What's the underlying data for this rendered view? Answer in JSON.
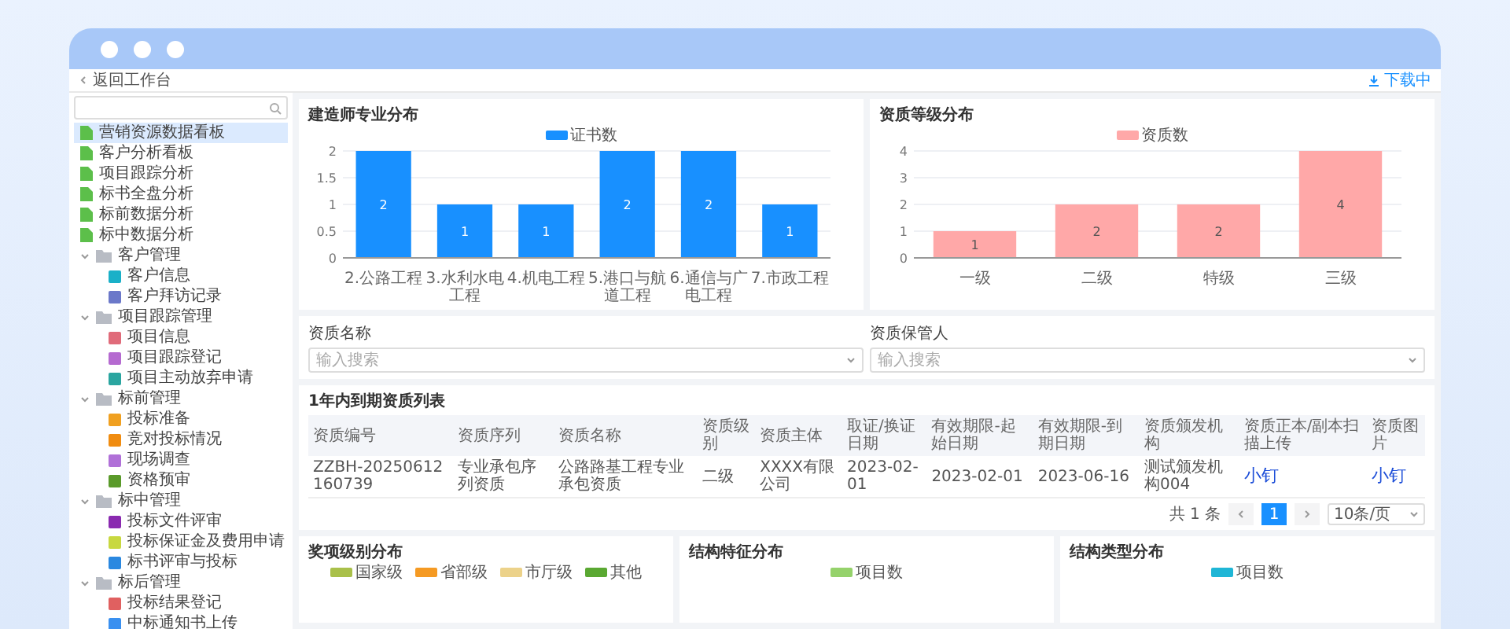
{
  "header": {
    "back_label": "返回工作台",
    "right_link": "下载中"
  },
  "sidebar": {
    "items": [
      {
        "label": "营销资源数据看板",
        "selected": true,
        "color": "#5cbf4a"
      },
      {
        "label": "客户分析看板",
        "selected": false,
        "color": "#5cbf4a"
      },
      {
        "label": "项目跟踪分析",
        "selected": false,
        "color": "#5cbf4a"
      },
      {
        "label": "标书全盘分析",
        "selected": false,
        "color": "#5cbf4a"
      },
      {
        "label": "标前数据分析",
        "selected": false,
        "color": "#5cbf4a"
      },
      {
        "label": "标中数据分析",
        "selected": false,
        "color": "#5cbf4a"
      },
      {
        "label": "客户管理",
        "selected": false,
        "expanded": true,
        "children": [
          {
            "label": "客户信息",
            "selected": false,
            "color": "#1ab0c8"
          },
          {
            "label": "客户拜访记录",
            "selected": false,
            "color": "#6b78c9"
          }
        ]
      },
      {
        "label": "项目跟踪管理",
        "selected": false,
        "expanded": true,
        "children": [
          {
            "label": "项目信息",
            "selected": false,
            "color": "#e06b7a"
          },
          {
            "label": "项目跟踪登记",
            "selected": false,
            "color": "#b56ad0"
          },
          {
            "label": "项目主动放弃申请",
            "selected": false,
            "color": "#2aa5a0"
          }
        ]
      },
      {
        "label": "标前管理",
        "selected": false,
        "expanded": true,
        "children": [
          {
            "label": "投标准备",
            "selected": false,
            "color": "#f0a020"
          },
          {
            "label": "竞对投标情况",
            "selected": false,
            "color": "#f08c10"
          },
          {
            "label": "现场调查",
            "selected": false,
            "color": "#b070d8"
          },
          {
            "label": "资格预审",
            "selected": false,
            "color": "#5a9a2a"
          }
        ]
      },
      {
        "label": "标中管理",
        "selected": false,
        "expanded": true,
        "children": [
          {
            "label": "投标文件评审",
            "selected": false,
            "color": "#8a2ab0"
          },
          {
            "label": "投标保证金及费用申请",
            "selected": false,
            "color": "#c8d840"
          },
          {
            "label": "标书评审与投标",
            "selected": false,
            "color": "#2a88e0"
          }
        ]
      },
      {
        "label": "标后管理",
        "selected": false,
        "expanded": true,
        "children": [
          {
            "label": "投标结果登记",
            "selected": false,
            "color": "#e06060"
          },
          {
            "label": "中标通知书上传",
            "selected": false,
            "color": "#3a90f0"
          }
        ]
      }
    ]
  },
  "top_charts": [
    {
      "title": "建造师专业分布",
      "chart_data": {
        "type": "bar",
        "categories": [
          "2.公路工程",
          "3.水利水电工程",
          "4.机电工程",
          "5.港口与航道工程",
          "6.通信与广电工程",
          "7.市政工程"
        ],
        "series": [
          {
            "name": "证书数",
            "color": "#1890ff",
            "values": [
              2,
              1,
              1,
              2,
              2,
              1
            ]
          }
        ],
        "yticks": [
          0,
          0.5,
          1,
          1.5,
          2
        ],
        "ylim": [
          0,
          2
        ],
        "grid": true,
        "data_labels": true
      }
    },
    {
      "title": "资质等级分布",
      "chart_data": {
        "type": "bar",
        "categories": [
          "一级",
          "二级",
          "特级",
          "三级"
        ],
        "series": [
          {
            "name": "资质数",
            "color": "#ffa8a8",
            "values": [
              1,
              2,
              2,
              4
            ]
          }
        ],
        "yticks": [
          0,
          1,
          2,
          3,
          4
        ],
        "ylim": [
          0,
          4
        ],
        "grid": true,
        "data_labels": true
      }
    }
  ],
  "filters": [
    {
      "label": "资质名称",
      "placeholder": "输入搜索"
    },
    {
      "label": "资质保管人",
      "placeholder": "输入搜索"
    }
  ],
  "table": {
    "title": "1年内到期资质列表",
    "columns": [
      "资质编号",
      "资质序列",
      "资质名称",
      "资质级别",
      "资质主体",
      "取证/换证日期",
      "有效期限-起始日期",
      "有效期限-到期日期",
      "资质颁发机构",
      "资质正本/副本扫描上传",
      "资质图片"
    ],
    "rows": [
      [
        {
          "text": "ZZBH-20250612160739",
          "kind": "text"
        },
        {
          "text": "专业承包序列资质",
          "kind": "text"
        },
        {
          "text": "公路路基工程专业承包资质",
          "kind": "text"
        },
        {
          "text": "二级",
          "kind": "text"
        },
        {
          "text": "XXXX有限公司",
          "kind": "text"
        },
        {
          "text": "2023-02-01",
          "kind": "text"
        },
        {
          "text": "2023-02-01",
          "kind": "text"
        },
        {
          "text": "2023-06-16",
          "kind": "text"
        },
        {
          "text": "测试颁发机构004",
          "kind": "text"
        },
        {
          "text": "小钉",
          "kind": "link"
        },
        {
          "text": "小钉",
          "kind": "link"
        }
      ]
    ]
  },
  "pagination": {
    "total": "共 1 条",
    "pages": [
      {
        "label": "1",
        "selected": true
      }
    ],
    "page_size": "10条/页"
  },
  "bottom_charts": [
    {
      "title": "奖项级别分布",
      "legend": [
        {
          "name": "国家级",
          "color": "#a9c04a"
        },
        {
          "name": "省部级",
          "color": "#f59a23"
        },
        {
          "name": "市厅级",
          "color": "#ecd28a"
        },
        {
          "name": "其他",
          "color": "#5aa832"
        }
      ]
    },
    {
      "title": "结构特征分布",
      "legend": [
        {
          "name": "项目数",
          "color": "#95d26b"
        }
      ]
    },
    {
      "title": "结构类型分布",
      "legend": [
        {
          "name": "项目数",
          "color": "#1fb6d6"
        }
      ]
    }
  ]
}
